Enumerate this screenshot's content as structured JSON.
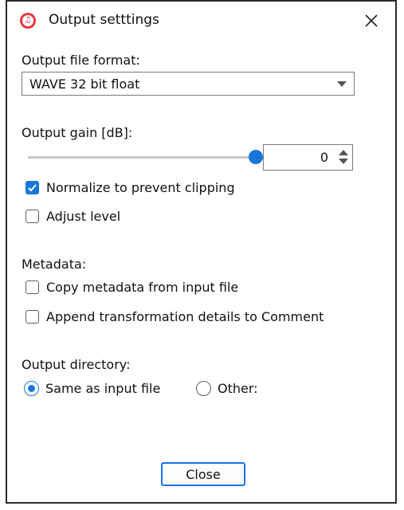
{
  "window": {
    "title": "Output setttings"
  },
  "format": {
    "label": "Output file format:",
    "selected": "WAVE 32 bit float"
  },
  "gain": {
    "label": "Output gain [dB]:",
    "value": "0",
    "slider_level": 1.0
  },
  "options": {
    "normalize": {
      "label": "Normalize to prevent clipping",
      "checked": true
    },
    "adjust_level": {
      "label": "Adjust level",
      "checked": false
    }
  },
  "metadata": {
    "label": "Metadata:",
    "copy": {
      "label": "Copy metadata from input file",
      "checked": false
    },
    "append": {
      "label": "Append transformation details to Comment",
      "checked": false
    }
  },
  "directory": {
    "label": "Output directory:",
    "same": {
      "label": "Same as input file",
      "selected": true
    },
    "other": {
      "label": "Other:",
      "selected": false
    }
  },
  "buttons": {
    "close": "Close"
  },
  "colors": {
    "accent": "#1776d9",
    "icon": "#e8353e",
    "button_border": "#1a73e8"
  }
}
